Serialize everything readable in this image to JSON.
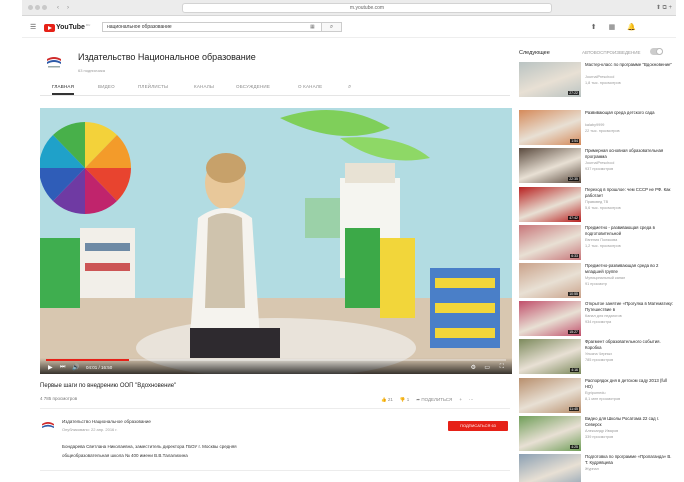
{
  "browser": {
    "url": "m.youtube.com"
  },
  "header": {
    "logo_text": "YouTube",
    "logo_sup": "RU",
    "search_value": "национальное образование"
  },
  "channel": {
    "title": "Издательство Национальное образование",
    "subscribers": "63 подписчика",
    "tabs": [
      {
        "label": "ГЛАВНАЯ",
        "active": true
      },
      {
        "label": "ВИДЕО"
      },
      {
        "label": "ПЛЕЙЛИСТЫ"
      },
      {
        "label": "КАНАЛЫ"
      },
      {
        "label": "ОБСУЖДЕНИЕ"
      },
      {
        "label": "О КАНАЛЕ"
      }
    ]
  },
  "player": {
    "time": "04:01 / 16:50",
    "progress": 0.18
  },
  "video": {
    "title": "Первые шаги по внедрению ООП \"Вдохновение\"",
    "views": "4 785 просмотров",
    "likes": "21",
    "dislikes": "1",
    "share": "ПОДЕЛИТЬСЯ",
    "owner": "Издательство Национальное образование",
    "published": "Опубликовано: 22 апр. 2016 г.",
    "subscribe": "ПОДПИСАТЬСЯ 63",
    "description": [
      "Бондарева Светлана Николаевна, заместитель директора ГБОУ г. Москвы средняя",
      "общеобразовательная школа № 400 имени В.В.Талалихина"
    ]
  },
  "sidebar": {
    "up_next": "Следующее",
    "autoplay": "АВТОВОСПРОИЗВЕДЕНИЕ",
    "items": [
      {
        "title": "Мастер-класс по программе \"Вдохновение\"",
        "channel": "JournalPreschool",
        "views": "1,8 тыс. просмотров",
        "duration": "27:22",
        "thumb": "#b9c3c2"
      },
      {
        "title": "Развивающая среда детского сада",
        "channel": "kalaby9999",
        "views": "22 тыс. просмотров",
        "duration": "1:54",
        "thumb": "#d58a5a"
      },
      {
        "title": "Примерная основная образовательная программа",
        "channel": "JournalPreschool",
        "views": "937 просмотров",
        "duration": "22:35",
        "thumb": "#5a4a3e"
      },
      {
        "title": "Переход в прошлое: чем СССР не РФ. Как работает",
        "channel": "Правовед ТВ",
        "views": "5,6 тыс. просмотров",
        "duration": "47:42",
        "thumb": "#b82020"
      },
      {
        "title": "Предметно - развивающая среда в подготовительной",
        "channel": "Евгения Полякова",
        "views": "1,2 тыс. просмотров",
        "duration": "6:33",
        "thumb": "#c8767a"
      },
      {
        "title": "Предметно-развивающая среда во 2 младшей группе",
        "channel": "Муниципальный канал",
        "views": "91 просмотр",
        "duration": "10:55",
        "thumb": "#caa28a"
      },
      {
        "title": "Открытое занятие «Прогулка в Математику: Путешествие в",
        "channel": "Канал для педагогов",
        "views": "934 просмотра",
        "duration": "15:27",
        "thumb": "#c14f6b"
      },
      {
        "title": "Фрагмент образовательного события. Коробка",
        "channel": "Ульяна Черных",
        "views": "785 просмотров",
        "duration": "4:16",
        "thumb": "#7c8a5c"
      },
      {
        "title": "Распорядок дня в детском саду 2013 (full HD)",
        "channel": "Egripumedu",
        "views": "8,1 млн просмотров",
        "duration": "11:45",
        "thumb": "#b88f6d"
      },
      {
        "title": "Видео для Школы Росатома 22 сад г. Северск",
        "channel": "Александр Иваров",
        "views": "339 просмотров",
        "duration": "4:25",
        "thumb": "#6f9e58"
      },
      {
        "title": "Подготовка по программе «Пропаганда» В. Т. Кудрявцева",
        "channel": "Журнал",
        "views": "",
        "duration": "",
        "thumb": "#8ba0b3"
      }
    ]
  }
}
